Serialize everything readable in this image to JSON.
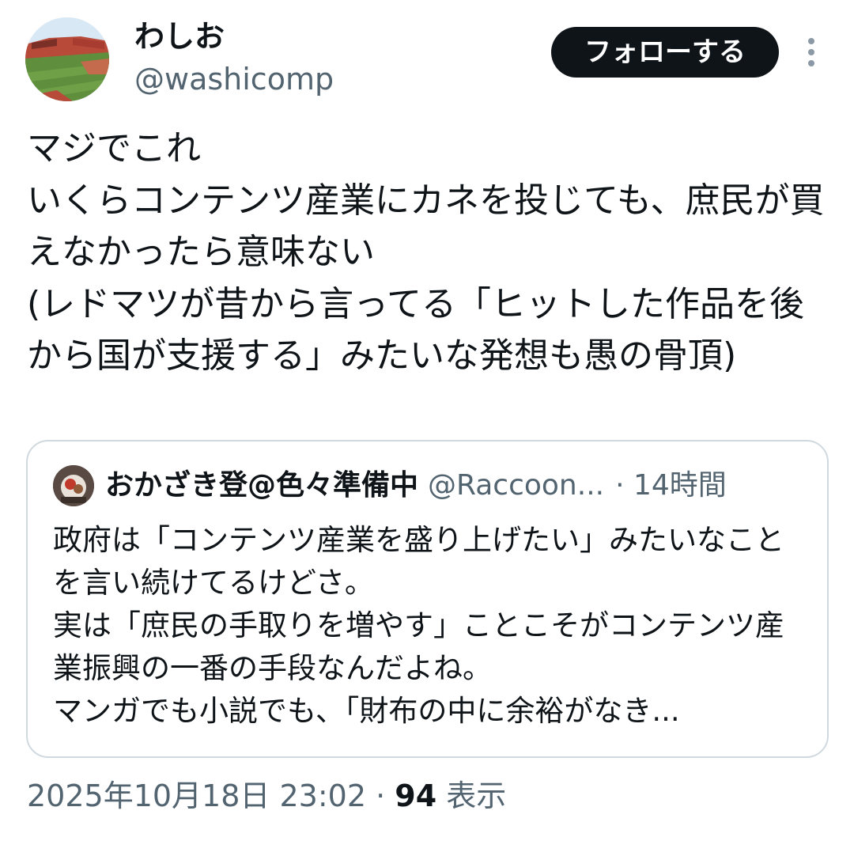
{
  "author": {
    "display_name": "わしお",
    "handle": "@washicomp",
    "avatar_icon": "stadium-photo-avatar"
  },
  "follow_button": {
    "label": "フォローする"
  },
  "more_icon": "more-vertical-icon",
  "tweet": {
    "text": "マジでこれ\nいくらコンテンツ産業にカネを投じても、庶民が買えなかったら意味ない\n(レドマツが昔から言ってる「ヒットした作品を後から国が支援する」みたいな発想も愚の骨頂)"
  },
  "quote": {
    "display_name": "おかざき登@色々準備中",
    "handle": "@Raccoon...",
    "time": "· 14時間",
    "text": "政府は「コンテンツ産業を盛り上げたい」みたいなことを言い続けてるけどさ。\n実は「庶民の手取りを増やす」ことこそがコンテンツ産業振興の一番の手段なんだよね。\nマンガでも小説でも、「財布の中に余裕がなき..."
  },
  "meta": {
    "timestamp": "2025年10月18日 23:02",
    "separator": "·",
    "views_count": "94",
    "views_label": "表示"
  },
  "colors": {
    "text": "#0f1419",
    "secondary": "#536471",
    "border": "#cfd9de",
    "button_bg": "#0f1419"
  }
}
